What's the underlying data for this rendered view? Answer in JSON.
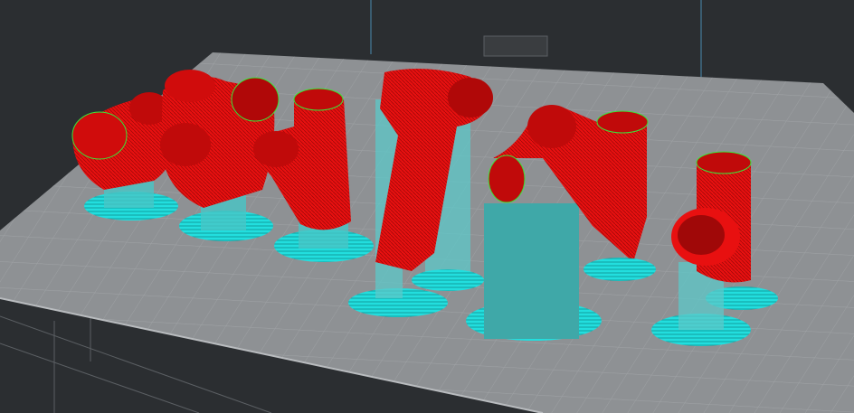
{
  "viewport": {
    "background_color": "#2b2e31",
    "plate_color": "#8e9194",
    "grid_color": "#a6a9ac",
    "model_color": "#f01010",
    "seam_color": "#39e639",
    "support_color": "#1fd6d6"
  }
}
